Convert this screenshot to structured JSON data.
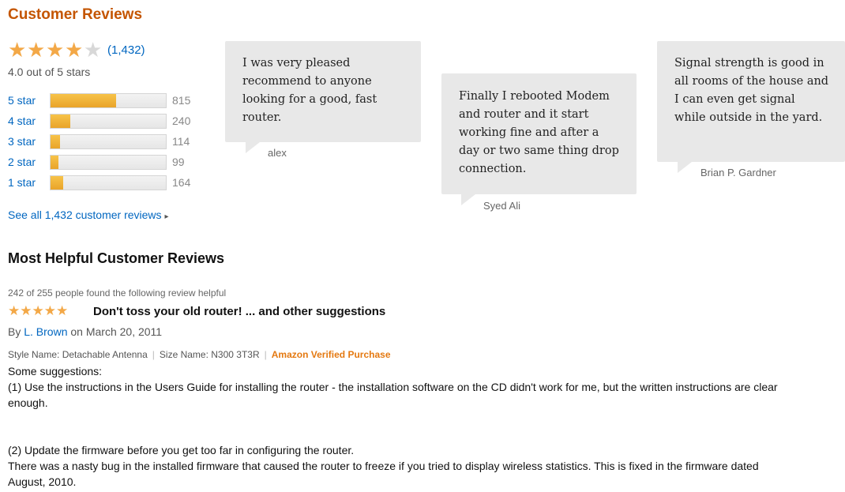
{
  "section_title": "Customer Reviews",
  "rating_summary": {
    "stars_filled": 4,
    "stars_total": 5,
    "review_count_link": "(1,432)",
    "average_text": "4.0 out of 5 stars"
  },
  "histogram": [
    {
      "label": "5 star",
      "count": "815",
      "fraction": 0.57
    },
    {
      "label": "4 star",
      "count": "240",
      "fraction": 0.17
    },
    {
      "label": "3 star",
      "count": "114",
      "fraction": 0.08
    },
    {
      "label": "2 star",
      "count": "99",
      "fraction": 0.07
    },
    {
      "label": "1 star",
      "count": "164",
      "fraction": 0.11
    }
  ],
  "see_all_link": "See all 1,432 customer reviews",
  "see_all_arrow": "▸",
  "quotes": [
    {
      "text": "I was very pleased recommend to anyone looking for a good, fast router.",
      "author": "alex"
    },
    {
      "text": "Finally I rebooted Modem and router and it start working fine and after a day or two same thing drop connection.",
      "author": "Syed Ali"
    },
    {
      "text": "Signal strength is good in all rooms of the house and I can even get signal while outside in the yard.",
      "author": "Brian P. Gardner"
    }
  ],
  "most_helpful_title": "Most Helpful Customer Reviews",
  "review": {
    "helpful_text": "242 of 255 people found the following review helpful",
    "stars_filled": 5,
    "title": "Don't toss your old router! ... and other suggestions",
    "by_prefix": "By",
    "author": "L. Brown",
    "date_text": "on March 20, 2011",
    "style_name": "Style Name: Detachable Antenna",
    "size_name": "Size Name: N300 3T3R",
    "separator": "|",
    "verified": "Amazon Verified Purchase",
    "body": [
      "Some suggestions:",
      "(1) Use the instructions in the Users Guide for installing the router - the installation software on the CD didn't work for me, but the written instructions are clear enough.",
      "(2) Update the firmware before you get too far in configuring the router.",
      "There was a nasty bug in the installed firmware that caused the router to freeze if you tried to display wireless statistics. This is fixed in the firmware dated August, 2010."
    ]
  },
  "colors": {
    "section_title": "#c45500",
    "link": "#0066c0",
    "star": "#f3a847",
    "bar_fill": "#f0b43a",
    "bubble": "#e8e8e8",
    "verified": "#e47911"
  }
}
